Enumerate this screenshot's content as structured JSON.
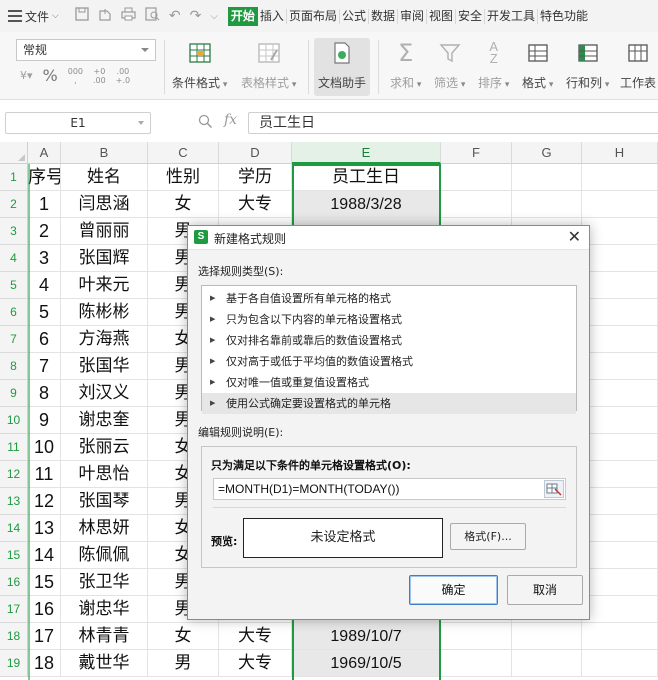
{
  "menubar": {
    "file_label": "文件",
    "tabs": [
      {
        "label": "开始",
        "active": true
      },
      {
        "label": "插入"
      },
      {
        "label": "页面布局"
      },
      {
        "label": "公式"
      },
      {
        "label": "数据"
      },
      {
        "label": "审阅"
      },
      {
        "label": "视图"
      },
      {
        "label": "安全"
      },
      {
        "label": "开发工具"
      },
      {
        "label": "特色功能"
      }
    ]
  },
  "ribbon": {
    "number_format": "常规",
    "buttons": {
      "conditional_format": "条件格式",
      "table_style": "表格样式",
      "doc_helper": "文档助手",
      "sum": "求和",
      "filter": "筛选",
      "sort": "排序",
      "format": "格式",
      "rows_cols": "行和列",
      "worksheet": "工作表"
    }
  },
  "formula_bar": {
    "cell_ref": "E1",
    "fx_label": "fx",
    "content": "员工生日"
  },
  "grid": {
    "columns": [
      "A",
      "B",
      "C",
      "D",
      "E",
      "F",
      "G",
      "H"
    ],
    "rows": [
      "1",
      "2",
      "3",
      "4",
      "5",
      "6",
      "7",
      "8",
      "9",
      "10",
      "11",
      "12",
      "13",
      "14",
      "15",
      "16",
      "17",
      "18",
      "19"
    ],
    "cells": [
      [
        "序号",
        "姓名",
        "性别",
        "学历",
        "员工生日"
      ],
      [
        "1",
        "闫思涵",
        "女",
        "大专",
        "1988/3/28"
      ],
      [
        "2",
        "曾丽丽",
        "男",
        "",
        ""
      ],
      [
        "3",
        "张国辉",
        "男",
        "",
        ""
      ],
      [
        "4",
        "叶来元",
        "男",
        "",
        ""
      ],
      [
        "5",
        "陈彬彬",
        "男",
        "",
        ""
      ],
      [
        "6",
        "方海燕",
        "女",
        "",
        ""
      ],
      [
        "7",
        "张国华",
        "男",
        "",
        ""
      ],
      [
        "8",
        "刘汉义",
        "男",
        "",
        ""
      ],
      [
        "9",
        "谢忠奎",
        "男",
        "",
        ""
      ],
      [
        "10",
        "张丽云",
        "女",
        "",
        ""
      ],
      [
        "11",
        "叶思怡",
        "女",
        "",
        ""
      ],
      [
        "12",
        "张国琴",
        "男",
        "",
        ""
      ],
      [
        "13",
        "林思妍",
        "女",
        "",
        ""
      ],
      [
        "14",
        "陈佩佩",
        "女",
        "",
        ""
      ],
      [
        "15",
        "张卫华",
        "男",
        "",
        ""
      ],
      [
        "16",
        "谢忠华",
        "男",
        "",
        ""
      ],
      [
        "17",
        "林青青",
        "女",
        "大专",
        "1989/10/7"
      ],
      [
        "18",
        "戴世华",
        "男",
        "大专",
        "1969/10/5"
      ]
    ]
  },
  "dialog": {
    "title": "新建格式规则",
    "rule_type_label": "选择规则类型(S):",
    "rule_types": [
      "基于各自值设置所有单元格的格式",
      "只为包含以下内容的单元格设置格式",
      "仅对排名靠前或靠后的数值设置格式",
      "仅对高于或低于平均值的数值设置格式",
      "仅对唯一值或重复值设置格式",
      "使用公式确定要设置格式的单元格"
    ],
    "selected_rule_index": 5,
    "edit_desc_label": "编辑规则说明(E):",
    "condition_label": "只为满足以下条件的单元格设置格式(O):",
    "formula": "=MONTH(D1)=MONTH(TODAY())",
    "preview_label": "预览:",
    "preview_text": "未设定格式",
    "format_button": "格式(F)...",
    "ok_button": "确定",
    "cancel_button": "取消"
  },
  "colors": {
    "accent_green": "#1f9a41",
    "ok_border_blue": "#3c7fc8"
  }
}
